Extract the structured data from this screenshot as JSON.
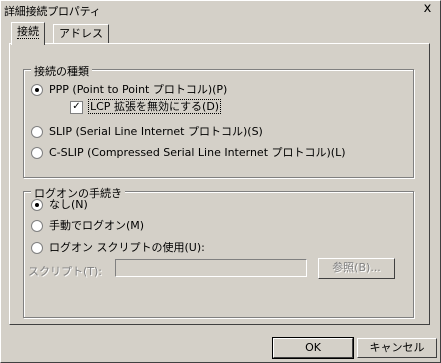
{
  "window": {
    "title": "詳細接続プロパティ",
    "close_glyph": "x"
  },
  "tabs": [
    {
      "label": "接続"
    },
    {
      "label": "アドレス"
    }
  ],
  "connection_type": {
    "legend": "接続の種類",
    "ppp": {
      "label": "PPP (Point to Point プロトコル)(P)",
      "selected": true
    },
    "lcp": {
      "label": "LCP 拡張を無効にする(D)",
      "checked": true
    },
    "slip": {
      "label": "SLIP (Serial Line Internet プロトコル)(S)",
      "selected": false
    },
    "cslip": {
      "label": "C-SLIP (Compressed Serial Line Internet プロトコル)(L)",
      "selected": false
    }
  },
  "logon": {
    "legend": "ログオンの手続き",
    "none": {
      "label": "なし(N)",
      "selected": true
    },
    "manual": {
      "label": "手動でログオン(M)",
      "selected": false
    },
    "script": {
      "label": "ログオン スクリプトの使用(U):",
      "selected": false
    },
    "script_field_label": "スクリプト(T):",
    "script_value": "",
    "browse_label": "参照(B)..."
  },
  "buttons": {
    "ok": "OK",
    "cancel": "キャンセル"
  }
}
